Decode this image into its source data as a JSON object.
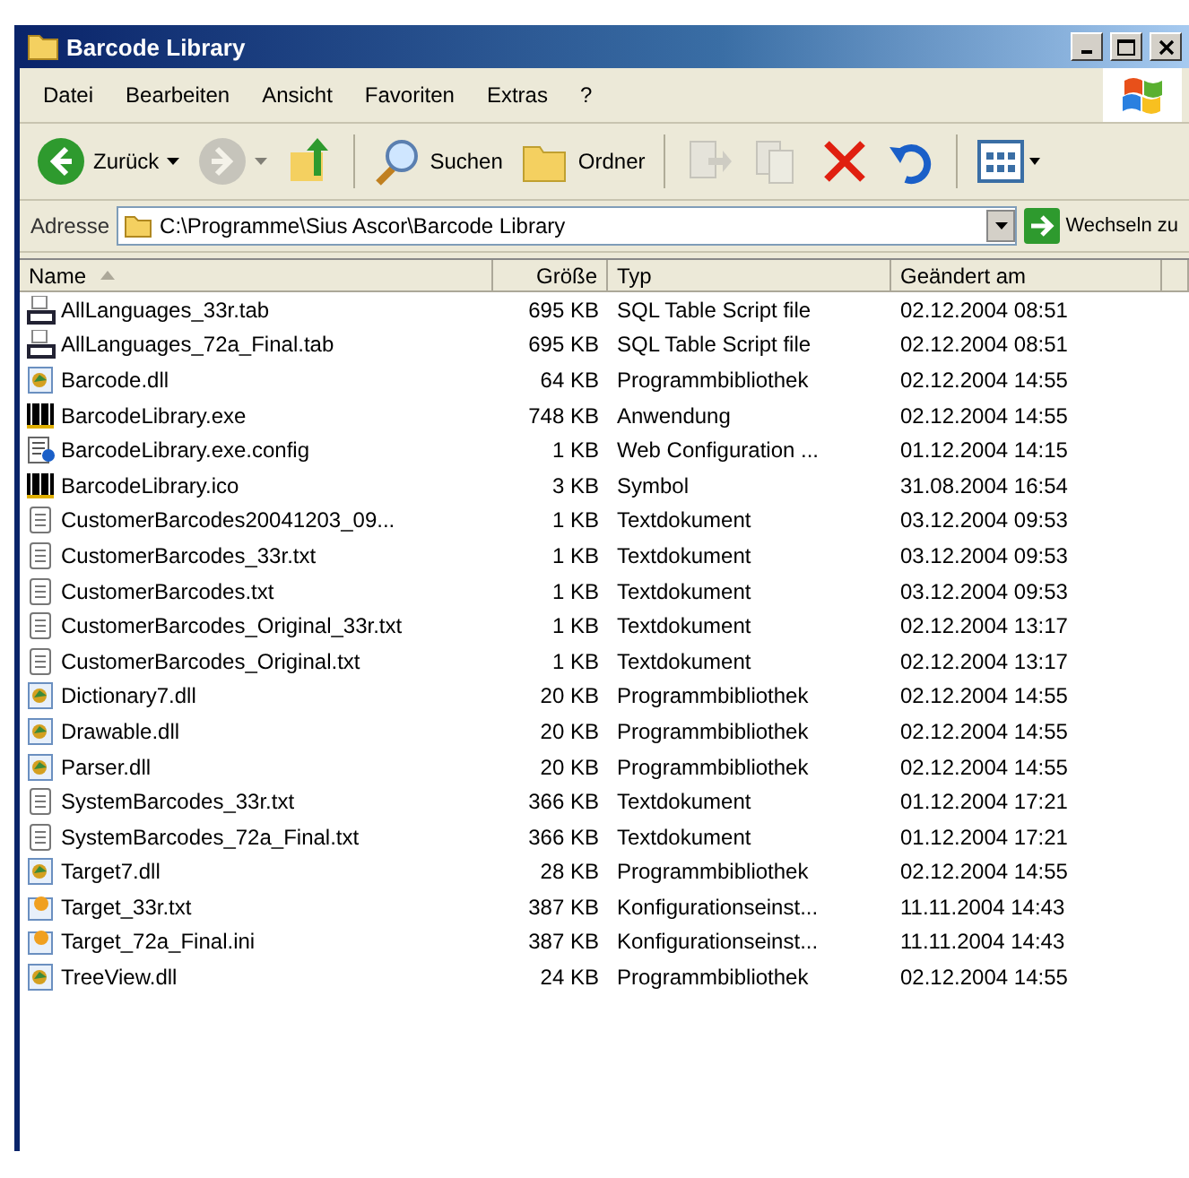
{
  "window": {
    "title": "Barcode Library"
  },
  "menu": [
    "Datei",
    "Bearbeiten",
    "Ansicht",
    "Favoriten",
    "Extras",
    "?"
  ],
  "toolbar": [
    {
      "kind": "back",
      "label": "Zurück",
      "disabled": false
    },
    {
      "kind": "forward",
      "disabled": true
    },
    {
      "kind": "up",
      "disabled": false
    },
    {
      "kind": "search",
      "label": "Suchen",
      "disabled": false
    },
    {
      "kind": "folders",
      "label": "Ordner",
      "disabled": false
    },
    {
      "kind": "move",
      "disabled": true
    },
    {
      "kind": "copy",
      "disabled": true
    },
    {
      "kind": "delete",
      "disabled": false
    },
    {
      "kind": "undo",
      "disabled": false
    },
    {
      "kind": "views",
      "disabled": false
    }
  ],
  "address": {
    "label": "Adresse",
    "value": "C:\\Programme\\Sius Ascor\\Barcode Library",
    "go": "Wechseln zu"
  },
  "table": {
    "columns": [
      {
        "label": "Name",
        "sorted": true
      },
      {
        "label": "Größe",
        "sorted": false
      },
      {
        "label": "Typ",
        "sorted": false
      },
      {
        "label": "Geändert am",
        "sorted": false
      }
    ],
    "rows": [
      {
        "kind": "sql",
        "name": "AllLanguages_33r.tab",
        "size": "695 KB",
        "type": "SQL Table Script file",
        "modified": "02.12.2004 08:51"
      },
      {
        "kind": "sql",
        "name": "AllLanguages_72a_Final.tab",
        "size": "695 KB",
        "type": "SQL Table Script file",
        "modified": "02.12.2004 08:51"
      },
      {
        "kind": "dll",
        "name": "Barcode.dll",
        "size": "64 KB",
        "type": "Programmbibliothek",
        "modified": "02.12.2004 14:55"
      },
      {
        "kind": "barcode",
        "name": "BarcodeLibrary.exe",
        "size": "748 KB",
        "type": "Anwendung",
        "modified": "02.12.2004 14:55"
      },
      {
        "kind": "config",
        "name": "BarcodeLibrary.exe.config",
        "size": "1 KB",
        "type": "Web Configuration ...",
        "modified": "01.12.2004 14:15"
      },
      {
        "kind": "barcode",
        "name": "BarcodeLibrary.ico",
        "size": "3 KB",
        "type": "Symbol",
        "modified": "31.08.2004 16:54"
      },
      {
        "kind": "text",
        "name": "CustomerBarcodes20041203_09...",
        "size": "1 KB",
        "type": "Textdokument",
        "modified": "03.12.2004 09:53"
      },
      {
        "kind": "text",
        "name": "CustomerBarcodes_33r.txt",
        "size": "1 KB",
        "type": "Textdokument",
        "modified": "03.12.2004 09:53"
      },
      {
        "kind": "text",
        "name": "CustomerBarcodes.txt",
        "size": "1 KB",
        "type": "Textdokument",
        "modified": "03.12.2004 09:53"
      },
      {
        "kind": "text",
        "name": "CustomerBarcodes_Original_33r.txt",
        "size": "1 KB",
        "type": "Textdokument",
        "modified": "02.12.2004 13:17"
      },
      {
        "kind": "text",
        "name": "CustomerBarcodes_Original.txt",
        "size": "1 KB",
        "type": "Textdokument",
        "modified": "02.12.2004 13:17"
      },
      {
        "kind": "dll",
        "name": "Dictionary7.dll",
        "size": "20 KB",
        "type": "Programmbibliothek",
        "modified": "02.12.2004 14:55"
      },
      {
        "kind": "dll",
        "name": "Drawable.dll",
        "size": "20 KB",
        "type": "Programmbibliothek",
        "modified": "02.12.2004 14:55"
      },
      {
        "kind": "dll",
        "name": "Parser.dll",
        "size": "20 KB",
        "type": "Programmbibliothek",
        "modified": "02.12.2004 14:55"
      },
      {
        "kind": "text",
        "name": "SystemBarcodes_33r.txt",
        "size": "366 KB",
        "type": "Textdokument",
        "modified": "01.12.2004 17:21"
      },
      {
        "kind": "text",
        "name": "SystemBarcodes_72a_Final.txt",
        "size": "366 KB",
        "type": "Textdokument",
        "modified": "01.12.2004 17:21"
      },
      {
        "kind": "dll",
        "name": "Target7.dll",
        "size": "28 KB",
        "type": "Programmbibliothek",
        "modified": "02.12.2004 14:55"
      },
      {
        "kind": "ini",
        "name": "Target_33r.txt",
        "size": "387 KB",
        "type": "Konfigurationseinst...",
        "modified": "11.11.2004 14:43"
      },
      {
        "kind": "ini",
        "name": "Target_72a_Final.ini",
        "size": "387 KB",
        "type": "Konfigurationseinst...",
        "modified": "11.11.2004 14:43"
      },
      {
        "kind": "dll",
        "name": "TreeView.dll",
        "size": "24 KB",
        "type": "Programmbibliothek",
        "modified": "02.12.2004 14:55"
      }
    ]
  }
}
